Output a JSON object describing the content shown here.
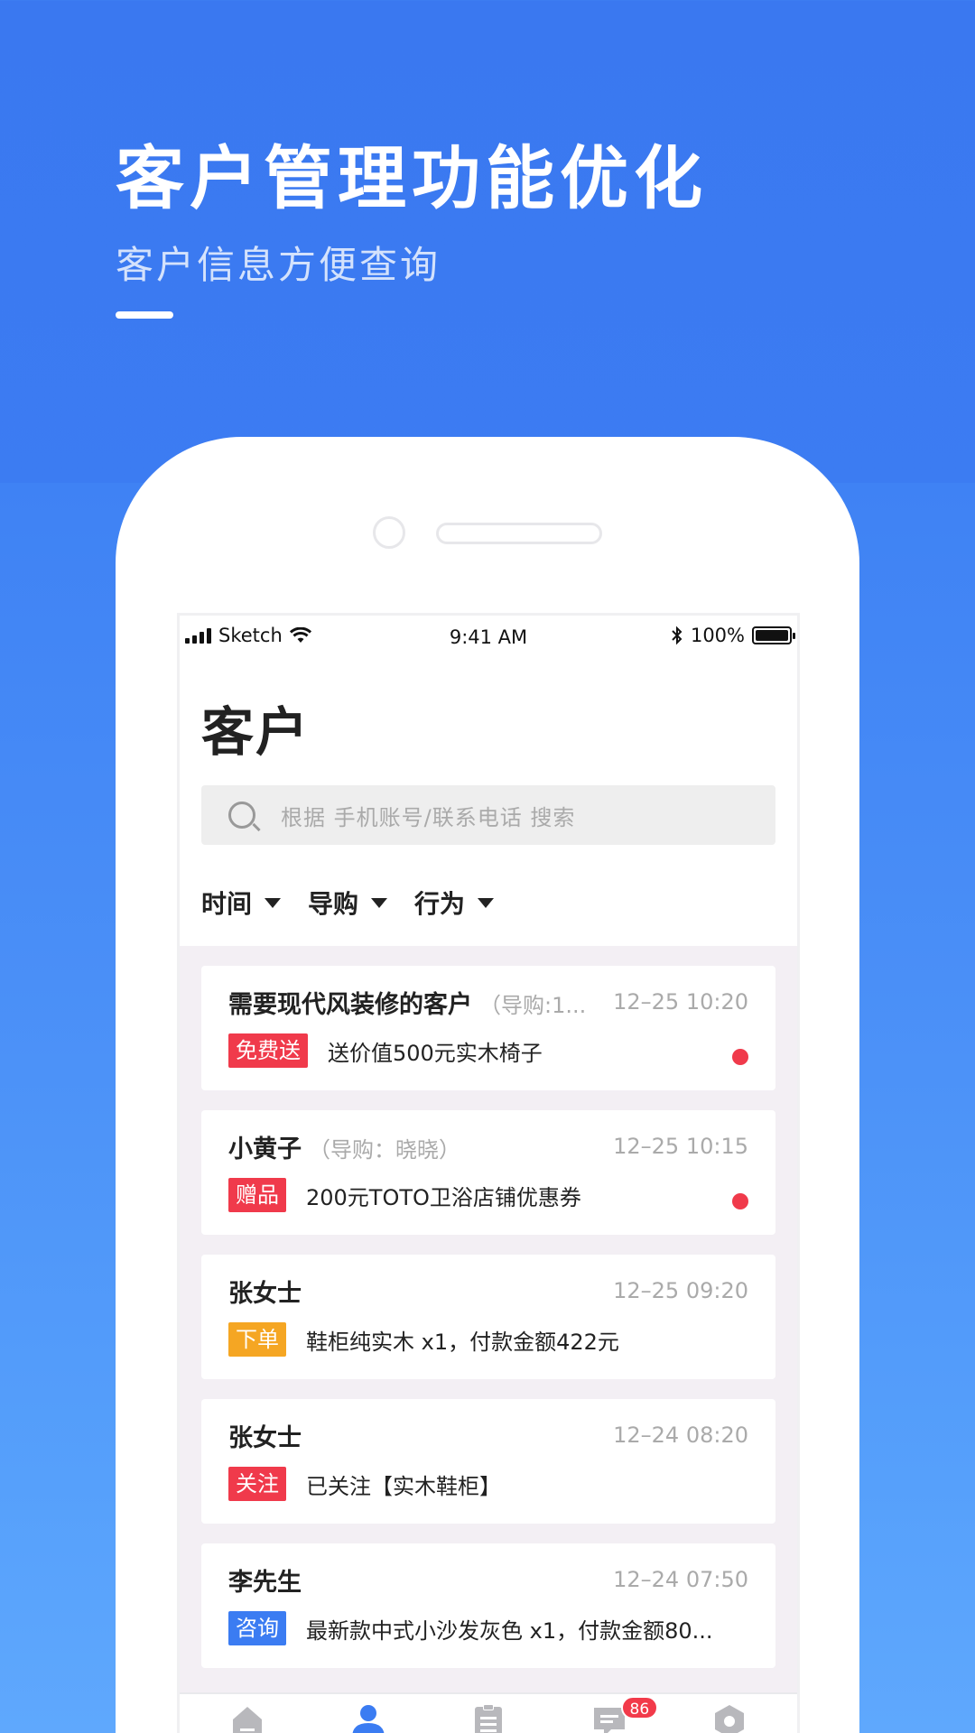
{
  "hero": {
    "title": "客户管理功能优化",
    "subtitle": "客户信息方便查询"
  },
  "status_bar": {
    "carrier": "Sketch",
    "time": "9:41 AM",
    "battery": "100%"
  },
  "page": {
    "title": "客户",
    "search_placeholder": "根据 手机账号/联系电话  搜索"
  },
  "filters": [
    {
      "label": "时间"
    },
    {
      "label": "导购"
    },
    {
      "label": "行为"
    }
  ],
  "customers": [
    {
      "name": "需要现代风装修的客户",
      "guide": "（导购:1...",
      "time": "12–25 10:20",
      "tag": "免费送",
      "tag_color": "#f03a4b",
      "desc": "送价值500元实木椅子",
      "unread": true
    },
    {
      "name": "小黄子",
      "guide": "（导购：晓晓）",
      "time": "12–25 10:15",
      "tag": "赠品",
      "tag_color": "#f03a4b",
      "desc": "200元TOTO卫浴店铺优惠券",
      "unread": true
    },
    {
      "name": "张女士",
      "guide": "",
      "time": "12–25 09:20",
      "tag": "下单",
      "tag_color": "#f5a623",
      "desc": "鞋柜纯实木 x1，付款金额422元",
      "unread": false
    },
    {
      "name": "张女士",
      "guide": "",
      "time": "12–24 08:20",
      "tag": "关注",
      "tag_color": "#f03a4b",
      "desc": "已关注【实木鞋柜】",
      "unread": false
    },
    {
      "name": "李先生",
      "guide": "",
      "time": "12–24 07:50",
      "tag": "咨询",
      "tag_color": "#3b7cf2",
      "desc": "最新款中式小沙发灰色 x1，付款金额80...",
      "unread": false
    }
  ],
  "tabs": [
    {
      "label": "主页",
      "icon": "home-icon",
      "active": false
    },
    {
      "label": "客户",
      "icon": "person-icon",
      "active": true
    },
    {
      "label": "订单",
      "icon": "clipboard-icon",
      "active": false
    },
    {
      "label": "消息",
      "icon": "message-icon",
      "active": false,
      "badge": "86"
    },
    {
      "label": "设置",
      "icon": "gear-icon",
      "active": false
    }
  ],
  "colors": {
    "accent": "#3b7cf2",
    "unread_dot": "#f03a4b",
    "tab_inactive_icon": "#b8b8bc"
  }
}
